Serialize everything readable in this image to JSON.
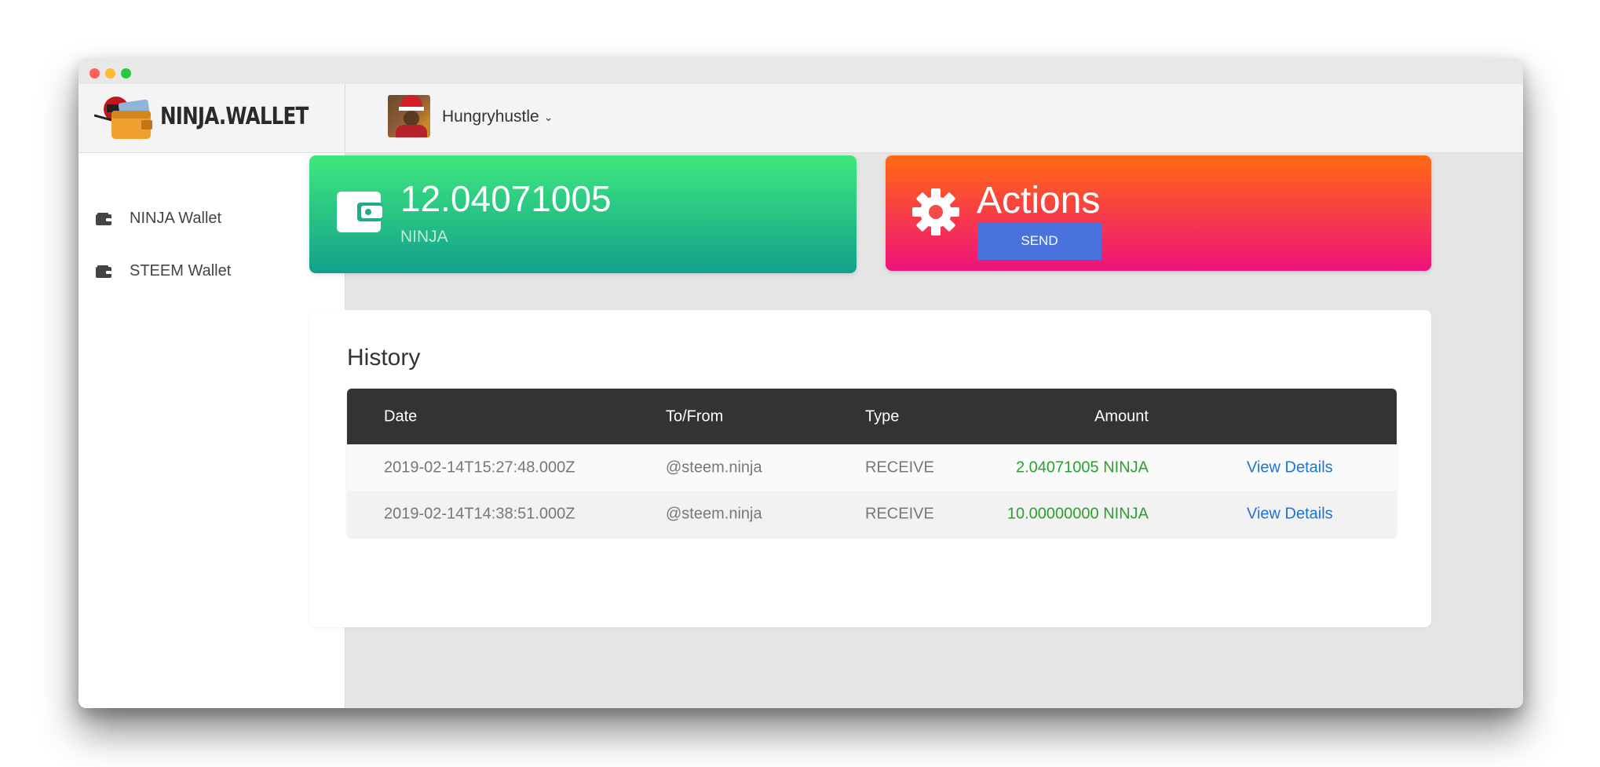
{
  "app": {
    "brand_name": "NINJA.WALLET"
  },
  "sidebar": {
    "items": [
      {
        "label": "NINJA Wallet",
        "icon": "wallet-icon"
      },
      {
        "label": "STEEM Wallet",
        "icon": "wallet-icon"
      }
    ]
  },
  "header": {
    "username": "Hungryhustle",
    "dropdown_icon": "chevron-down-icon"
  },
  "balance_card": {
    "value": "12.04071005",
    "unit": "NINJA",
    "icon": "wallet-icon"
  },
  "actions_card": {
    "title": "Actions",
    "send_label": "SEND",
    "icon": "gear-icon"
  },
  "history": {
    "title": "History",
    "columns": [
      "Date",
      "To/From",
      "Type",
      "Amount",
      ""
    ],
    "rows": [
      {
        "date": "2019-02-14T15:27:48.000Z",
        "to_from": "@steem.ninja",
        "type": "RECEIVE",
        "amount": "2.04071005 NINJA",
        "link": "View Details"
      },
      {
        "date": "2019-02-14T14:38:51.000Z",
        "to_from": "@steem.ninja",
        "type": "RECEIVE",
        "amount": "10.00000000 NINJA",
        "link": "View Details"
      }
    ]
  },
  "colors": {
    "balance_gradient": [
      "#3ee87d",
      "#13a08c"
    ],
    "actions_gradient": [
      "#ff6a12",
      "#f0127b"
    ],
    "send_button": "#4a72dc",
    "amount_text": "#2aa02f",
    "link_text": "#1e73d8",
    "table_header": "#333333"
  }
}
